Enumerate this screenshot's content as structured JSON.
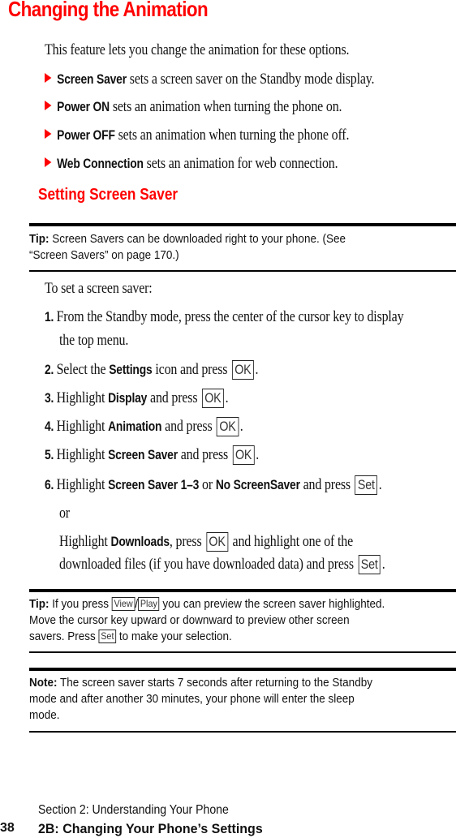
{
  "title": "Changing the Animation",
  "intro": "This feature lets you change the animation for these options.",
  "bullets": [
    {
      "term": "Screen Saver",
      "text": " sets a screen saver on the Standby mode display."
    },
    {
      "term": "Power ON",
      "text": " sets an animation when turning the phone on."
    },
    {
      "term": "Power OFF",
      "text": " sets an animation when turning the phone off."
    },
    {
      "term": "Web Connection",
      "text": " sets an animation for web connection."
    }
  ],
  "subheading": "Setting Screen Saver",
  "tip1": {
    "label": "Tip:",
    "text": " Screen Savers can be downloaded right to your phone. (See",
    "text2": "“Screen Savers” on page 170.)"
  },
  "steps_intro": "To set a screen saver:",
  "steps": [
    {
      "num": "1.",
      "line1": "From the Standby mode, press the center of the cursor key to display",
      "line2": "the top menu."
    },
    {
      "num": "2.",
      "pre": "Select the ",
      "term": "Settings",
      "post": " icon and press",
      "key": "OK",
      "end": "."
    },
    {
      "num": "3.",
      "pre": "Highlight ",
      "term": "Display",
      "post": " and press",
      "key": "OK",
      "end": "."
    },
    {
      "num": "4.",
      "pre": "Highlight ",
      "term": "Animation",
      "post": " and press",
      "key": "OK",
      "end": "."
    },
    {
      "num": "5.",
      "pre": "Highlight ",
      "term": "Screen Saver",
      "post": " and press",
      "key": "OK",
      "end": "."
    },
    {
      "num": "6.",
      "pre": "Highlight ",
      "term": "Screen Saver 1–3",
      "mid": " or ",
      "term2": "No ScreenSaver",
      "post": " and press",
      "key": "Set",
      "end": "."
    }
  ],
  "alt": {
    "or": "or",
    "pre": "Highlight ",
    "term": "Downloads",
    "mid": ", press",
    "key1": "OK",
    "post": " and highlight one of the",
    "line2": "downloaded files (if you have downloaded data) and press",
    "key2": "Set",
    "end": "."
  },
  "tip2": {
    "label": "Tip:",
    "pre": " If you press ",
    "key1": "View",
    "sep": "/",
    "key2": "Play",
    "post": " you can preview the screen saver highlighted.",
    "line2": "Move the cursor key upward or downward to preview other screen",
    "line3pre": "savers. Press ",
    "key3": "Set",
    "line3post": " to make your selection."
  },
  "note": {
    "label": "Note:",
    "text": " The screen saver starts 7 seconds after returning to the Standby",
    "line2": "mode and after another 30 minutes, your phone will enter the sleep",
    "line3": "mode."
  },
  "footer": {
    "section": "Section 2: Understanding Your Phone",
    "page": "38",
    "chapter": "2B: Changing Your Phone’s Settings"
  },
  "colors": {
    "heading": "#ff0000",
    "bullet_arrow": "#ff0000",
    "text": "#111111"
  }
}
